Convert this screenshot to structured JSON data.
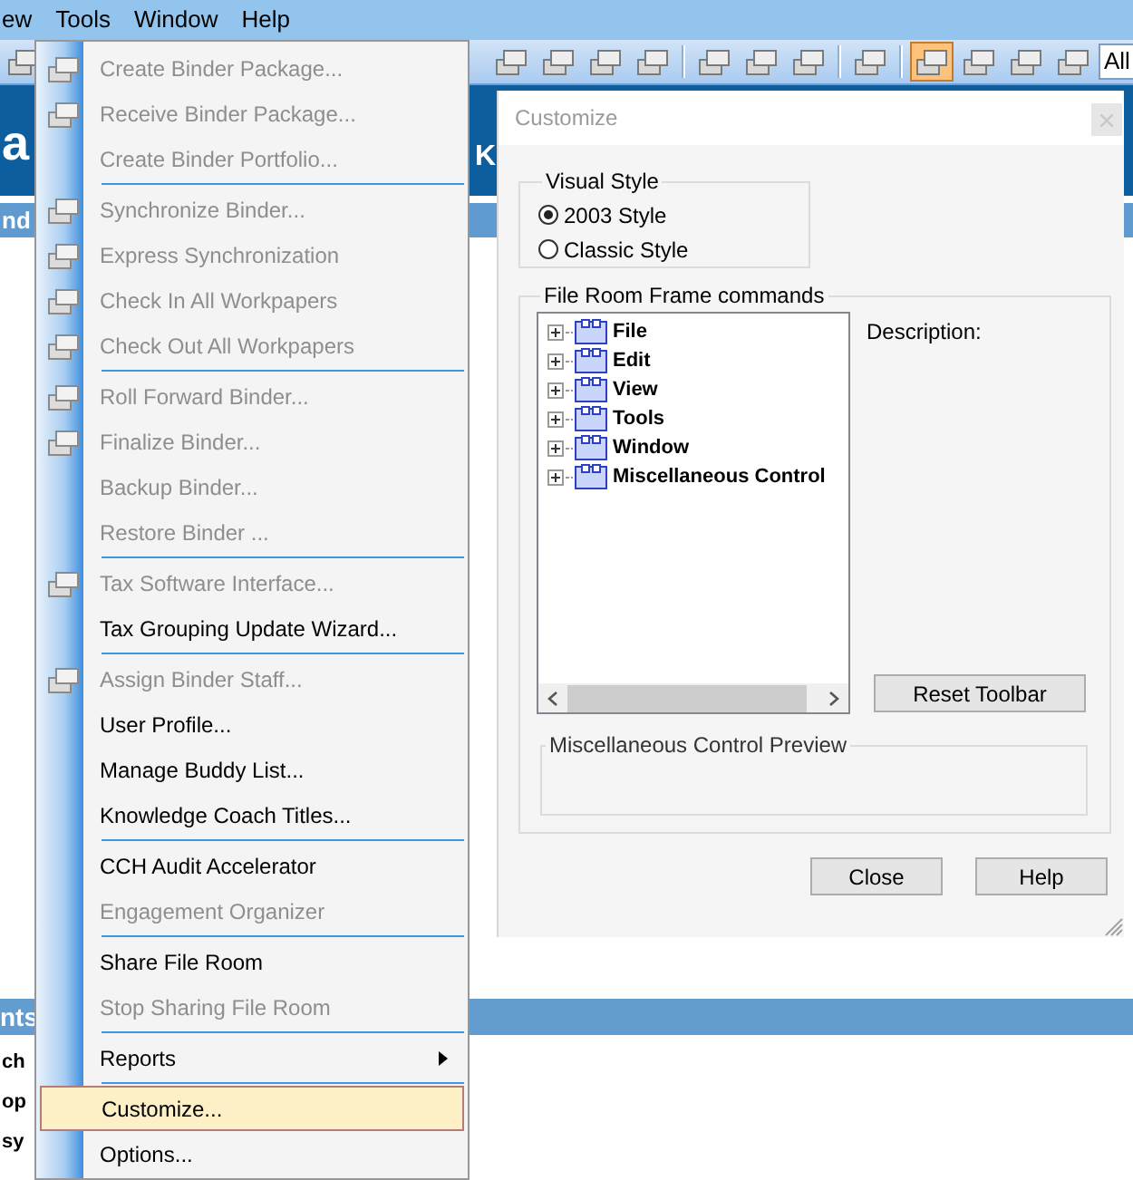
{
  "menubar": [
    {
      "label": "ew"
    },
    {
      "label": "Tools"
    },
    {
      "label": "Window"
    },
    {
      "label": "Help"
    }
  ],
  "toolbar": {
    "items": [
      {
        "kind": "button",
        "pressed": false
      },
      {
        "kind": "gap"
      },
      {
        "kind": "button",
        "pressed": false
      },
      {
        "kind": "button",
        "pressed": false
      },
      {
        "kind": "button",
        "pressed": false
      },
      {
        "kind": "button",
        "pressed": false
      },
      {
        "kind": "separator"
      },
      {
        "kind": "button",
        "pressed": false
      },
      {
        "kind": "button",
        "pressed": false
      },
      {
        "kind": "button",
        "pressed": false
      },
      {
        "kind": "separator"
      },
      {
        "kind": "button",
        "pressed": false
      },
      {
        "kind": "separator"
      },
      {
        "kind": "button",
        "pressed": true
      },
      {
        "kind": "button",
        "pressed": false
      },
      {
        "kind": "button",
        "pressed": false
      },
      {
        "kind": "button",
        "pressed": false
      }
    ],
    "combo": {
      "value": "All"
    }
  },
  "header": {
    "title_fragment": "a",
    "name_fragment": "K"
  },
  "subheader": {
    "label": "nd"
  },
  "section": {
    "title": "nts",
    "rows": [
      "ch",
      "op",
      "sy"
    ]
  },
  "tools_menu": {
    "items": [
      {
        "kind": "item",
        "label": "Create Binder Package...",
        "disabled": true,
        "has_icon": true,
        "highlighted": false,
        "submenu": false
      },
      {
        "kind": "item",
        "label": "Receive Binder Package...",
        "disabled": true,
        "has_icon": true,
        "highlighted": false,
        "submenu": false
      },
      {
        "kind": "item",
        "label": "Create Binder Portfolio...",
        "disabled": true,
        "has_icon": false,
        "highlighted": false,
        "submenu": false
      },
      {
        "kind": "separator"
      },
      {
        "kind": "item",
        "label": "Synchronize Binder...",
        "disabled": true,
        "has_icon": true,
        "highlighted": false,
        "submenu": false
      },
      {
        "kind": "item",
        "label": "Express Synchronization",
        "disabled": true,
        "has_icon": true,
        "highlighted": false,
        "submenu": false
      },
      {
        "kind": "item",
        "label": "Check In All Workpapers",
        "disabled": true,
        "has_icon": true,
        "highlighted": false,
        "submenu": false
      },
      {
        "kind": "item",
        "label": "Check Out All Workpapers",
        "disabled": true,
        "has_icon": true,
        "highlighted": false,
        "submenu": false
      },
      {
        "kind": "separator"
      },
      {
        "kind": "item",
        "label": "Roll Forward Binder...",
        "disabled": true,
        "has_icon": true,
        "highlighted": false,
        "submenu": false
      },
      {
        "kind": "item",
        "label": "Finalize Binder...",
        "disabled": true,
        "has_icon": true,
        "highlighted": false,
        "submenu": false
      },
      {
        "kind": "item",
        "label": "Backup Binder...",
        "disabled": true,
        "has_icon": false,
        "highlighted": false,
        "submenu": false
      },
      {
        "kind": "item",
        "label": "Restore Binder ...",
        "disabled": true,
        "has_icon": false,
        "highlighted": false,
        "submenu": false
      },
      {
        "kind": "separator"
      },
      {
        "kind": "item",
        "label": "Tax Software Interface...",
        "disabled": true,
        "has_icon": true,
        "highlighted": false,
        "submenu": false
      },
      {
        "kind": "item",
        "label": "Tax Grouping Update Wizard...",
        "disabled": false,
        "has_icon": false,
        "highlighted": false,
        "submenu": false
      },
      {
        "kind": "separator"
      },
      {
        "kind": "item",
        "label": "Assign Binder Staff...",
        "disabled": true,
        "has_icon": true,
        "highlighted": false,
        "submenu": false
      },
      {
        "kind": "item",
        "label": "User Profile...",
        "disabled": false,
        "has_icon": false,
        "highlighted": false,
        "submenu": false
      },
      {
        "kind": "item",
        "label": "Manage Buddy List...",
        "disabled": false,
        "has_icon": false,
        "highlighted": false,
        "submenu": false
      },
      {
        "kind": "item",
        "label": "Knowledge Coach Titles...",
        "disabled": false,
        "has_icon": false,
        "highlighted": false,
        "submenu": false
      },
      {
        "kind": "separator"
      },
      {
        "kind": "item",
        "label": "CCH Audit Accelerator",
        "disabled": false,
        "has_icon": false,
        "highlighted": false,
        "submenu": false
      },
      {
        "kind": "item",
        "label": "Engagement Organizer",
        "disabled": true,
        "has_icon": false,
        "highlighted": false,
        "submenu": false
      },
      {
        "kind": "separator"
      },
      {
        "kind": "item",
        "label": "Share File Room",
        "disabled": false,
        "has_icon": false,
        "highlighted": false,
        "submenu": false
      },
      {
        "kind": "item",
        "label": "Stop Sharing File Room",
        "disabled": true,
        "has_icon": false,
        "highlighted": false,
        "submenu": false
      },
      {
        "kind": "separator"
      },
      {
        "kind": "item",
        "label": "Reports",
        "disabled": false,
        "has_icon": false,
        "highlighted": false,
        "submenu": true
      },
      {
        "kind": "separator"
      },
      {
        "kind": "item",
        "label": "Customize...",
        "disabled": false,
        "has_icon": false,
        "highlighted": true,
        "submenu": false
      },
      {
        "kind": "item",
        "label": "Options...",
        "disabled": false,
        "has_icon": false,
        "highlighted": false,
        "submenu": false
      }
    ]
  },
  "dialog": {
    "title": "Customize",
    "visual_style": {
      "legend": "Visual Style",
      "options": [
        {
          "label": "2003 Style",
          "selected": true
        },
        {
          "label": "Classic Style",
          "selected": false
        }
      ]
    },
    "commands": {
      "legend": "File Room Frame commands",
      "tree": [
        {
          "label": "File",
          "expanded": false
        },
        {
          "label": "Edit",
          "expanded": false
        },
        {
          "label": "View",
          "expanded": false
        },
        {
          "label": "Tools",
          "expanded": false
        },
        {
          "label": "Window",
          "expanded": false
        },
        {
          "label": "Miscellaneous Control",
          "expanded": false
        }
      ],
      "description_label": "Description:",
      "reset_button": "Reset Toolbar",
      "preview_legend": "Miscellaneous Control Preview"
    },
    "buttons": [
      "Close",
      "Help"
    ]
  }
}
